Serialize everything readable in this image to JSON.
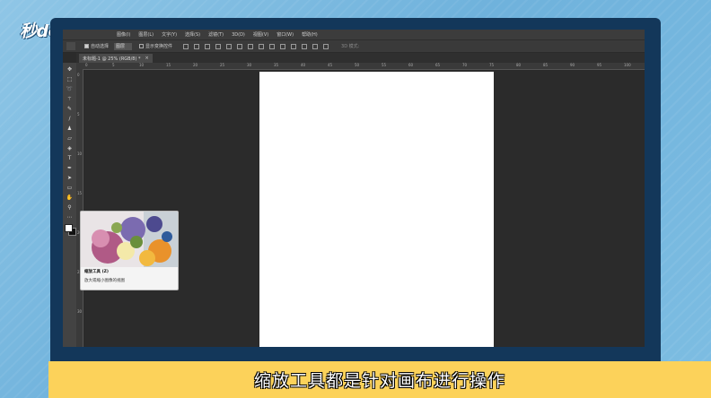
{
  "brand": {
    "logo_text": "秒dong视频"
  },
  "menubar": {
    "items": [
      {
        "label": "图像(I)"
      },
      {
        "label": "图层(L)"
      },
      {
        "label": "文字(Y)"
      },
      {
        "label": "选择(S)"
      },
      {
        "label": "滤镜(T)"
      },
      {
        "label": "3D(D)"
      },
      {
        "label": "视图(V)"
      },
      {
        "label": "窗口(W)"
      },
      {
        "label": "帮助(H)"
      }
    ]
  },
  "options_bar": {
    "auto_select_label": "自动选择",
    "auto_select_checked": true,
    "layer_select_value": "图层",
    "show_transform_label": "显示变换控件",
    "mode_3d_label": "3D 模式:"
  },
  "document_tab": {
    "label": "未标题-1 @ 25% (RGB/8) *",
    "close_label": "×"
  },
  "rulers": {
    "top_ticks": [
      "0",
      "5",
      "10",
      "15",
      "20",
      "25",
      "30",
      "35",
      "40",
      "45",
      "50",
      "55",
      "60",
      "65",
      "70",
      "75",
      "80",
      "85",
      "90",
      "95",
      "100"
    ],
    "left_ticks": [
      "0",
      "5",
      "10",
      "15",
      "20",
      "25",
      "30"
    ]
  },
  "toolbar": {
    "tools": [
      {
        "name": "move-tool-icon",
        "glyph": "✥"
      },
      {
        "name": "marquee-tool-icon",
        "glyph": "⬚"
      },
      {
        "name": "lasso-tool-icon",
        "glyph": "➰"
      },
      {
        "name": "magic-wand-tool-icon",
        "glyph": "⚚"
      },
      {
        "name": "eyedropper-tool-icon",
        "glyph": "✎"
      },
      {
        "name": "brush-tool-icon",
        "glyph": "∕"
      },
      {
        "name": "clone-stamp-tool-icon",
        "glyph": "♟"
      },
      {
        "name": "eraser-tool-icon",
        "glyph": "▱"
      },
      {
        "name": "gradient-tool-icon",
        "glyph": "◈"
      },
      {
        "name": "type-tool-icon",
        "glyph": "T"
      },
      {
        "name": "pen-tool-icon",
        "glyph": "✒"
      },
      {
        "name": "path-select-tool-icon",
        "glyph": "➤"
      },
      {
        "name": "rectangle-tool-icon",
        "glyph": "▭"
      },
      {
        "name": "hand-tool-icon",
        "glyph": "✋"
      },
      {
        "name": "zoom-tool-icon",
        "glyph": "⚲"
      },
      {
        "name": "more-tools-icon",
        "glyph": "⋯"
      }
    ]
  },
  "tooltip": {
    "title": "缩放工具 (Z)",
    "description": "放大或缩小图像的视图"
  },
  "subtitle": {
    "text": "缩放工具都是针对画布进行操作"
  }
}
